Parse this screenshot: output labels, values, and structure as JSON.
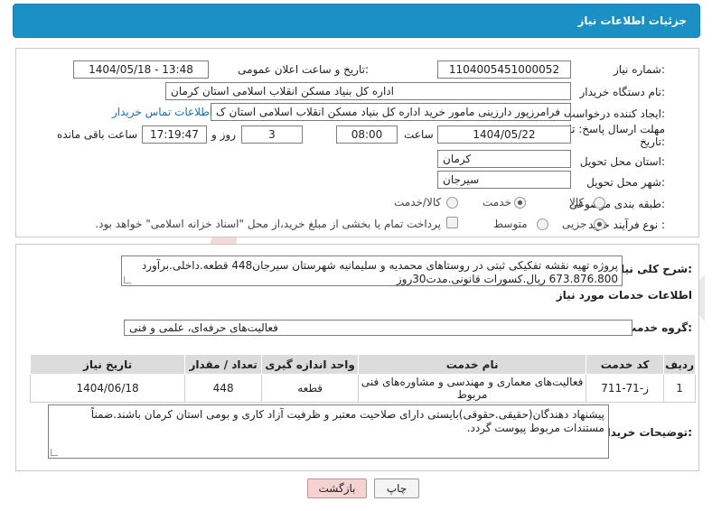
{
  "header": {
    "title": "جزئیات اطلاعات نیاز"
  },
  "fields": {
    "need_number_label": "شماره نیاز:",
    "need_number": "1104005451000052",
    "announce_label": "تاریخ و ساعت اعلان عمومی:",
    "announce_value": "1404/05/18 - 13:48",
    "buyer_label": "نام دستگاه خریدار:",
    "buyer_value": "اداره کل بنیاد مسکن انقلاب اسلامی استان کرمان",
    "creator_label": "ایجاد کننده درخواست:",
    "creator_value": "علی فرامرزپور دارزینی مامور خرید اداره کل بنیاد مسکن انقلاب اسلامی استان ک",
    "contact_link": "اطلاعات تماس خریدار",
    "deadline_label_line1": "مهلت ارسال پاسخ: تا",
    "deadline_label_line2": "تاریخ:",
    "deadline_date": "1404/05/22",
    "time_label": "ساعت",
    "deadline_time": "08:00",
    "days_value": "3",
    "days_label": "روز و",
    "remaining_time": "17:19:47",
    "remaining_label": "ساعت باقی مانده",
    "province_label": "استان محل تحویل:",
    "province_value": "کرمان",
    "city_label": "شهر محل تحویل:",
    "city_value": "سیرجان",
    "category_label": "طبقه بندی موضوعی:",
    "category_options": [
      "کالا",
      "خدمت",
      "کالا/خدمت"
    ],
    "category_selected": "خدمت",
    "process_label": "نوع فرآیند خرید :",
    "process_options": [
      "جزیی",
      "متوسط"
    ],
    "process_selected": "جزیی",
    "payment_note": "پرداخت تمام یا بخشی از مبلغ خرید،از محل \"اسناد خزانه اسلامی\" خواهد بود."
  },
  "summary": {
    "label": "شرح کلی نیاز:",
    "text": "پروژه تهیه نقشه تفکیکی ثبتی در روستاهای محمدیه و سلیمانیه شهرستان سیرجان448 قطعه.داخلی.برآورد 673.876.800 ریال.کسورات قانونی.مدت30روز"
  },
  "services": {
    "section_title": "اطلاعات خدمات مورد نیاز",
    "group_label": "گروه خدمت:",
    "group_value": "فعالیت‌های حرفه‌ای، علمی و فنی",
    "columns": [
      "ردیف",
      "کد خدمت",
      "نام خدمت",
      "واحد اندازه گیری",
      "تعداد / مقدار",
      "تاریخ نیاز"
    ],
    "rows": [
      [
        "1",
        "ز-71-711",
        "فعالیت‌های معماری و مهندسی و مشاوره‌های فنی مربوط",
        "قطعه",
        "448",
        "1404/06/18"
      ]
    ]
  },
  "buyer_notes": {
    "label": "توضیحات خریدار:",
    "text": "پیشنهاد دهندگان(حقیقی.حقوقی)بایستی دارای صلاحیت معتبر و ظرفیت آزاد کاری و بومی استان کرمان باشند.ضمناً مستندات مربوط پیوست گردد."
  },
  "buttons": {
    "print": "چاپ",
    "back": "بازگشت"
  },
  "watermark": {
    "text": "AriaTender.net"
  },
  "colors": {
    "header_bg": "#1a90c4",
    "link": "#1a6fb0",
    "back_btn": "#f7d2d2"
  }
}
